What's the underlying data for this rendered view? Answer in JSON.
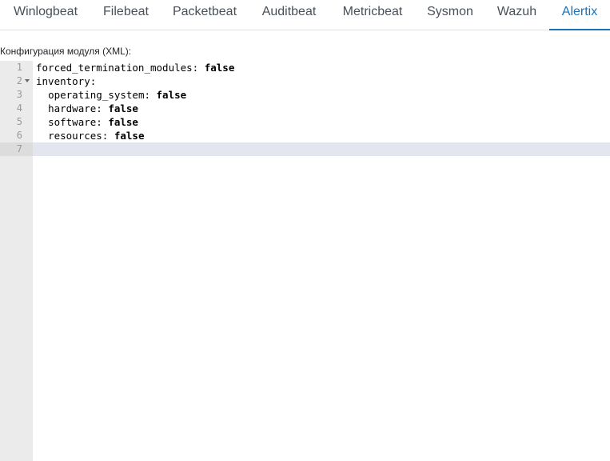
{
  "tabs": [
    {
      "label": "Winlogbeat",
      "active": false
    },
    {
      "label": "Filebeat",
      "active": false
    },
    {
      "label": "Packetbeat",
      "active": false
    },
    {
      "label": "Auditbeat",
      "active": false
    },
    {
      "label": "Metricbeat",
      "active": false
    },
    {
      "label": "Sysmon",
      "active": false
    },
    {
      "label": "Wazuh",
      "active": false
    },
    {
      "label": "Alertix",
      "active": true
    }
  ],
  "section_label": "Конфигурация модуля (XML):",
  "editor": {
    "lines": [
      {
        "number": "1",
        "indent": "",
        "key": "forced_termination_modules:",
        "value": "false",
        "foldable": false
      },
      {
        "number": "2",
        "indent": "",
        "key": "inventory:",
        "value": "",
        "foldable": true
      },
      {
        "number": "3",
        "indent": "  ",
        "key": "operating_system:",
        "value": "false",
        "foldable": false
      },
      {
        "number": "4",
        "indent": "  ",
        "key": "hardware:",
        "value": "false",
        "foldable": false
      },
      {
        "number": "5",
        "indent": "  ",
        "key": "software:",
        "value": "false",
        "foldable": false
      },
      {
        "number": "6",
        "indent": "  ",
        "key": "resources:",
        "value": "false",
        "foldable": false
      },
      {
        "number": "7",
        "indent": "",
        "key": "",
        "value": "",
        "foldable": false
      }
    ],
    "active_line": 7
  },
  "colors": {
    "accent": "#1a73b8",
    "gutter_bg": "#ebebeb",
    "active_line_bg": "#e3e6ef"
  }
}
